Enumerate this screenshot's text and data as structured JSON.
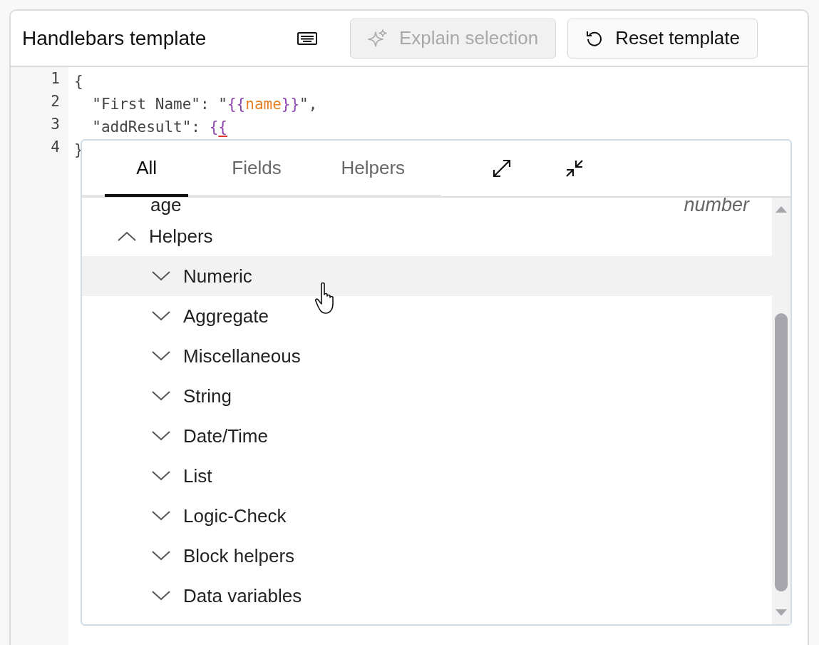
{
  "header": {
    "title": "Handlebars template",
    "buttons": [
      {
        "kind": "explain",
        "label": "Explain selection",
        "disabled": true
      },
      {
        "kind": "reset",
        "label": "Reset template",
        "disabled": false
      }
    ]
  },
  "editor": {
    "lines": [
      {
        "number": "1",
        "tokens": [
          {
            "kind": "punct",
            "text": "{"
          }
        ]
      },
      {
        "number": "2",
        "tokens": [
          {
            "kind": "string",
            "text": "  \"First Name\": \""
          },
          {
            "kind": "brace",
            "text": "{{"
          },
          {
            "kind": "var",
            "text": "name"
          },
          {
            "kind": "brace",
            "text": "}}"
          },
          {
            "kind": "string",
            "text": "\","
          }
        ]
      },
      {
        "number": "3",
        "tokens": [
          {
            "kind": "string",
            "text": "  \"addResult\": "
          },
          {
            "kind": "brace",
            "text": "{"
          },
          {
            "kind": "brace",
            "text": "{",
            "error": true
          }
        ]
      },
      {
        "number": "4",
        "tokens": [
          {
            "kind": "punct",
            "text": "}"
          }
        ]
      }
    ]
  },
  "autocomplete": {
    "tabs": [
      {
        "label": "All",
        "selected": true
      },
      {
        "label": "Fields",
        "selected": false
      },
      {
        "label": "Helpers",
        "selected": false
      }
    ],
    "items": [
      {
        "kind": "field",
        "label": "age",
        "type": "number"
      },
      {
        "kind": "group",
        "label": "Helpers",
        "expanded": true,
        "selected": false,
        "children": [
          {
            "kind": "group",
            "label": "Numeric",
            "expanded": false,
            "selected": true
          },
          {
            "kind": "group",
            "label": "Aggregate",
            "expanded": false,
            "selected": false
          },
          {
            "kind": "group",
            "label": "Miscellaneous",
            "expanded": false,
            "selected": false
          },
          {
            "kind": "group",
            "label": "String",
            "expanded": false,
            "selected": false
          },
          {
            "kind": "group",
            "label": "Date/Time",
            "expanded": false,
            "selected": false
          },
          {
            "kind": "group",
            "label": "List",
            "expanded": false,
            "selected": false
          },
          {
            "kind": "group",
            "label": "Logic-Check",
            "expanded": false,
            "selected": false
          },
          {
            "kind": "group",
            "label": "Block helpers",
            "expanded": false,
            "selected": false
          },
          {
            "kind": "group",
            "label": "Data variables",
            "expanded": false,
            "selected": false
          }
        ]
      }
    ]
  }
}
